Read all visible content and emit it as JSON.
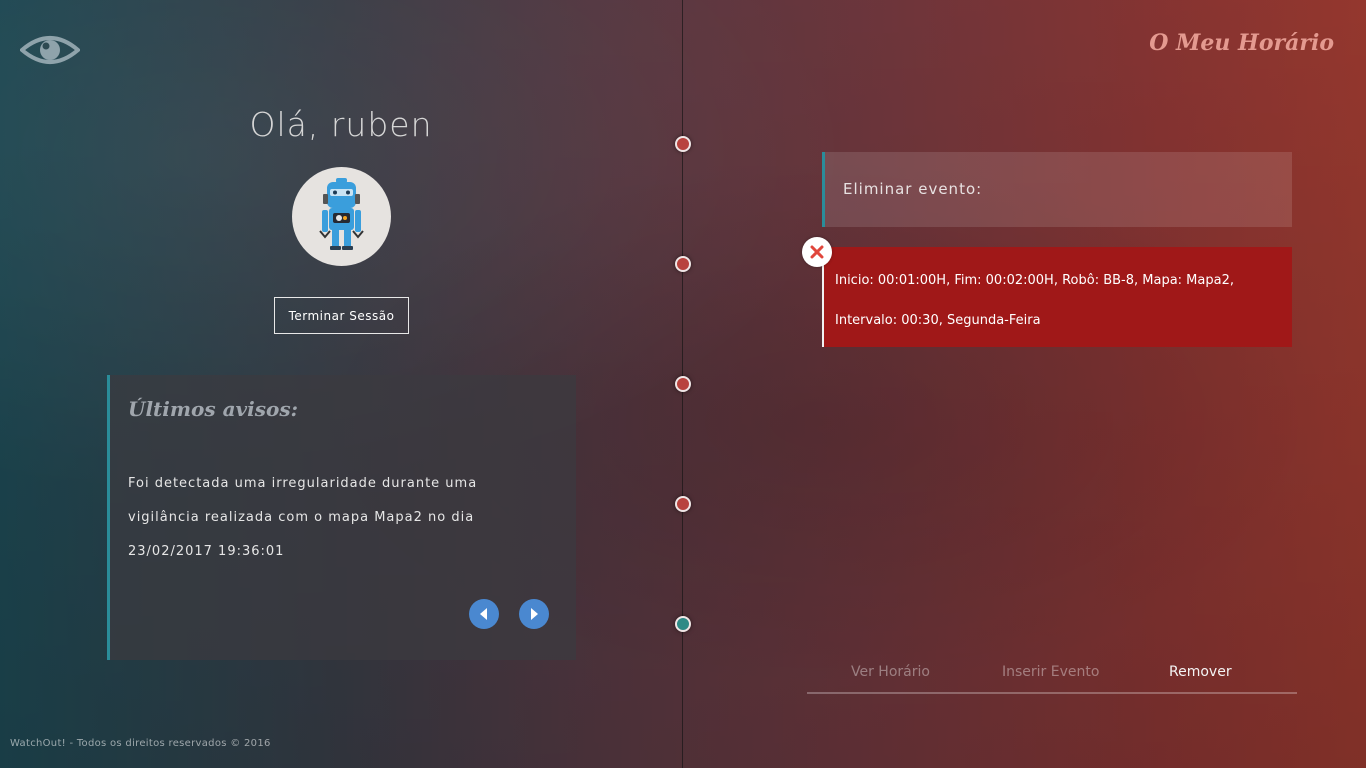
{
  "brand": {
    "title": "O Meu Horário",
    "logo_icon": "eye-icon"
  },
  "user": {
    "greeting": "Olá, ruben",
    "avatar_icon": "robot-icon"
  },
  "session": {
    "logout_label": "Terminar Sessão"
  },
  "notices": {
    "title": "Últimos avisos:",
    "message": "Foi detectada uma irregularidade durante uma vigilância realizada com o mapa Mapa2 no dia 23/02/2017 19:36:01",
    "prev_icon": "chevron-left-icon",
    "next_icon": "chevron-right-icon"
  },
  "delete_event": {
    "header": "Eliminar evento:",
    "event_line1": "Inicio: 00:01:00H, Fim: 00:02:00H, Robô: BB-8, Mapa: Mapa2,",
    "event_line2": "Intervalo: 00:30, Segunda-Feira",
    "delete_icon": "close-icon"
  },
  "tabs": [
    {
      "label": "Ver Horário",
      "active": false
    },
    {
      "label": "Inserir Evento",
      "active": false
    },
    {
      "label": "Remover",
      "active": true
    }
  ],
  "footer": {
    "text": "WatchOut! - Todos os direitos reservados © 2016"
  },
  "colors": {
    "accent_teal": "#2a8d9a",
    "event_red": "#a01818",
    "title_pink": "#e49a90",
    "nav_blue": "#4a88d0"
  }
}
